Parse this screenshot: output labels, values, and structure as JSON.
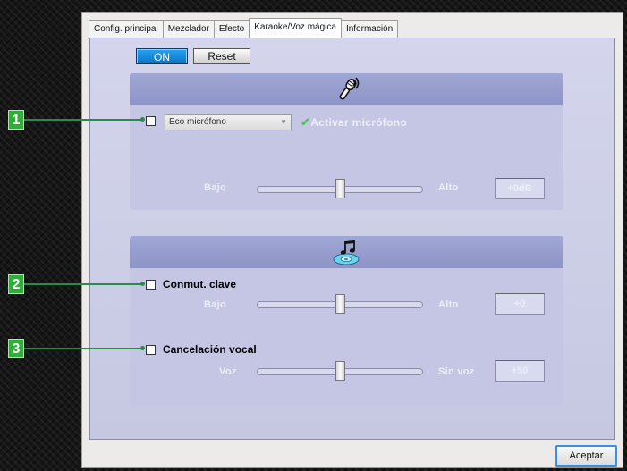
{
  "tabs": [
    {
      "label": "Config. principal"
    },
    {
      "label": "Mezclador"
    },
    {
      "label": "Efecto"
    },
    {
      "label": "Karaoke/Voz mágica",
      "active": true
    },
    {
      "label": "Información"
    }
  ],
  "controls": {
    "on_label": "ON",
    "reset_label": "Reset"
  },
  "mic_section": {
    "icon": "microphone-icon",
    "select_value": "Eco micrófono",
    "activate_label": "Activar micrófono",
    "slider_low": "Bajo",
    "slider_high": "Alto",
    "slider_level": 0.5,
    "value": "+0dB"
  },
  "music_section": {
    "icon": "music-cd-icon",
    "key_label": "Conmut. clave",
    "key_low": "Bajo",
    "key_high": "Alto",
    "key_level": 0.5,
    "key_value": "+0",
    "vocal_label": "Cancelación vocal",
    "vocal_low": "Voz",
    "vocal_high": "Sin voz",
    "vocal_level": 0.5,
    "vocal_value": "+50"
  },
  "callouts": [
    "1",
    "2",
    "3"
  ],
  "footer": {
    "accept_label": "Aceptar"
  },
  "colors": {
    "on_button": "#0a86dc",
    "callout": "#2fae3a",
    "panel": "#c8c9e4"
  }
}
